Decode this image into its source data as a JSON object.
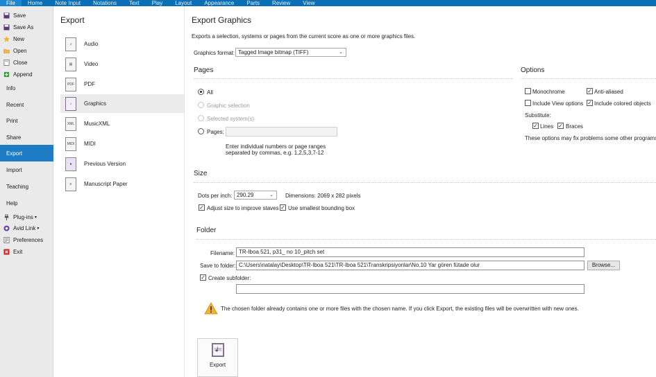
{
  "ribbon": {
    "tabs": [
      "File",
      "Home",
      "Note Input",
      "Notations",
      "Text",
      "Play",
      "Layout",
      "Appearance",
      "Parts",
      "Review",
      "View"
    ]
  },
  "left_menu": {
    "items": [
      {
        "label": "Save",
        "icon": "save-icon"
      },
      {
        "label": "Save As",
        "icon": "save-as-icon"
      },
      {
        "label": "New",
        "icon": "new-icon"
      },
      {
        "label": "Open",
        "icon": "open-folder-icon"
      },
      {
        "label": "Close",
        "icon": "close-icon"
      },
      {
        "label": "Append",
        "icon": "append-icon"
      },
      {
        "label": "Info"
      },
      {
        "label": "Recent"
      },
      {
        "label": "Print"
      },
      {
        "label": "Share"
      },
      {
        "label": "Export",
        "active": true
      },
      {
        "label": "Import"
      },
      {
        "label": "Teaching"
      },
      {
        "label": "Help"
      },
      {
        "label": "Plug-ins",
        "icon": "plug-icon"
      },
      {
        "label": "Avid Link",
        "icon": "avid-link-icon"
      },
      {
        "label": "Preferences",
        "icon": "preferences-icon"
      },
      {
        "label": "Exit",
        "icon": "exit-icon"
      }
    ]
  },
  "export_categories": {
    "heading": "Export",
    "items": [
      {
        "label": "Audio",
        "icon": "audio-file-icon"
      },
      {
        "label": "Video",
        "icon": "video-file-icon"
      },
      {
        "label": "PDF",
        "icon": "pdf-file-icon",
        "badge": "PDF"
      },
      {
        "label": "Graphics",
        "icon": "graphics-file-icon",
        "active": true
      },
      {
        "label": "MusicXML",
        "icon": "musicxml-file-icon",
        "badge": "XML"
      },
      {
        "label": "MIDI",
        "icon": "midi-file-icon",
        "badge": "MIDI"
      },
      {
        "label": "Previous Version",
        "icon": "previous-version-icon"
      },
      {
        "label": "Manuscript Paper",
        "icon": "manuscript-paper-icon"
      }
    ]
  },
  "graphics": {
    "title": "Export Graphics",
    "description": "Exports a selection, systems or pages from the current score as one or more graphics files.",
    "format_label": "Graphics format:",
    "format_value": "Tagged Image bitmap (TIFF)",
    "pages": {
      "heading": "Pages",
      "all_label": "All",
      "graphic_selection_label": "Graphic selection",
      "selected_systems_label": "Selected system(s)",
      "pages_label": "Pages:",
      "pages_value": "",
      "hint_line1": "Enter individual numbers or page ranges",
      "hint_line2": "separated by commas, e.g. 1,2,5,3,7-12"
    },
    "options": {
      "heading": "Options",
      "monochrome_label": "Monochrome",
      "monochrome_checked": false,
      "anti_aliased_label": "Anti-aliased",
      "anti_aliased_checked": true,
      "include_view_label": "Include View options",
      "include_view_checked": false,
      "include_colored_label": "Include colored objects",
      "include_colored_checked": true,
      "substitute_label": "Substitute:",
      "lines_label": "Lines",
      "lines_checked": true,
      "braces_label": "Braces",
      "braces_checked": true,
      "note": "These options may fix problems some other programs h"
    },
    "size": {
      "heading": "Size",
      "dpi_label": "Dots per inch:",
      "dpi_value": "290.29",
      "dimensions": "Dimensions: 2069 x 282 pixels",
      "adjust_label": "Adjust size to improve staves",
      "adjust_checked": true,
      "smallest_label": "Use smallest bounding box",
      "smallest_checked": true
    },
    "folder": {
      "heading": "Folder",
      "filename_label": "Filename:",
      "filename_value": "TR-Iboa 521, p31_ no 10_pitch set",
      "save_to_label": "Save to folder:",
      "save_to_value": "C:\\Users\\natalay\\Desktop\\TR-Iboa 521\\TR-Iboa 521\\Transkripsiyonlar\\No.10 Yar gören fütade olur",
      "browse_label": "Browse...",
      "create_subfolder_label": "Create subfolder:",
      "create_subfolder_checked": true,
      "subfolder_value": "",
      "warning": "The chosen folder already contains one or more files with the chosen name. If you click Export, the existing files will be overwritten with new ones."
    },
    "export_button_label": "Export"
  },
  "colors": {
    "ribbon": "#0a6fb5",
    "active_menu": "#1d7cc4",
    "warning": "#f2b233"
  }
}
